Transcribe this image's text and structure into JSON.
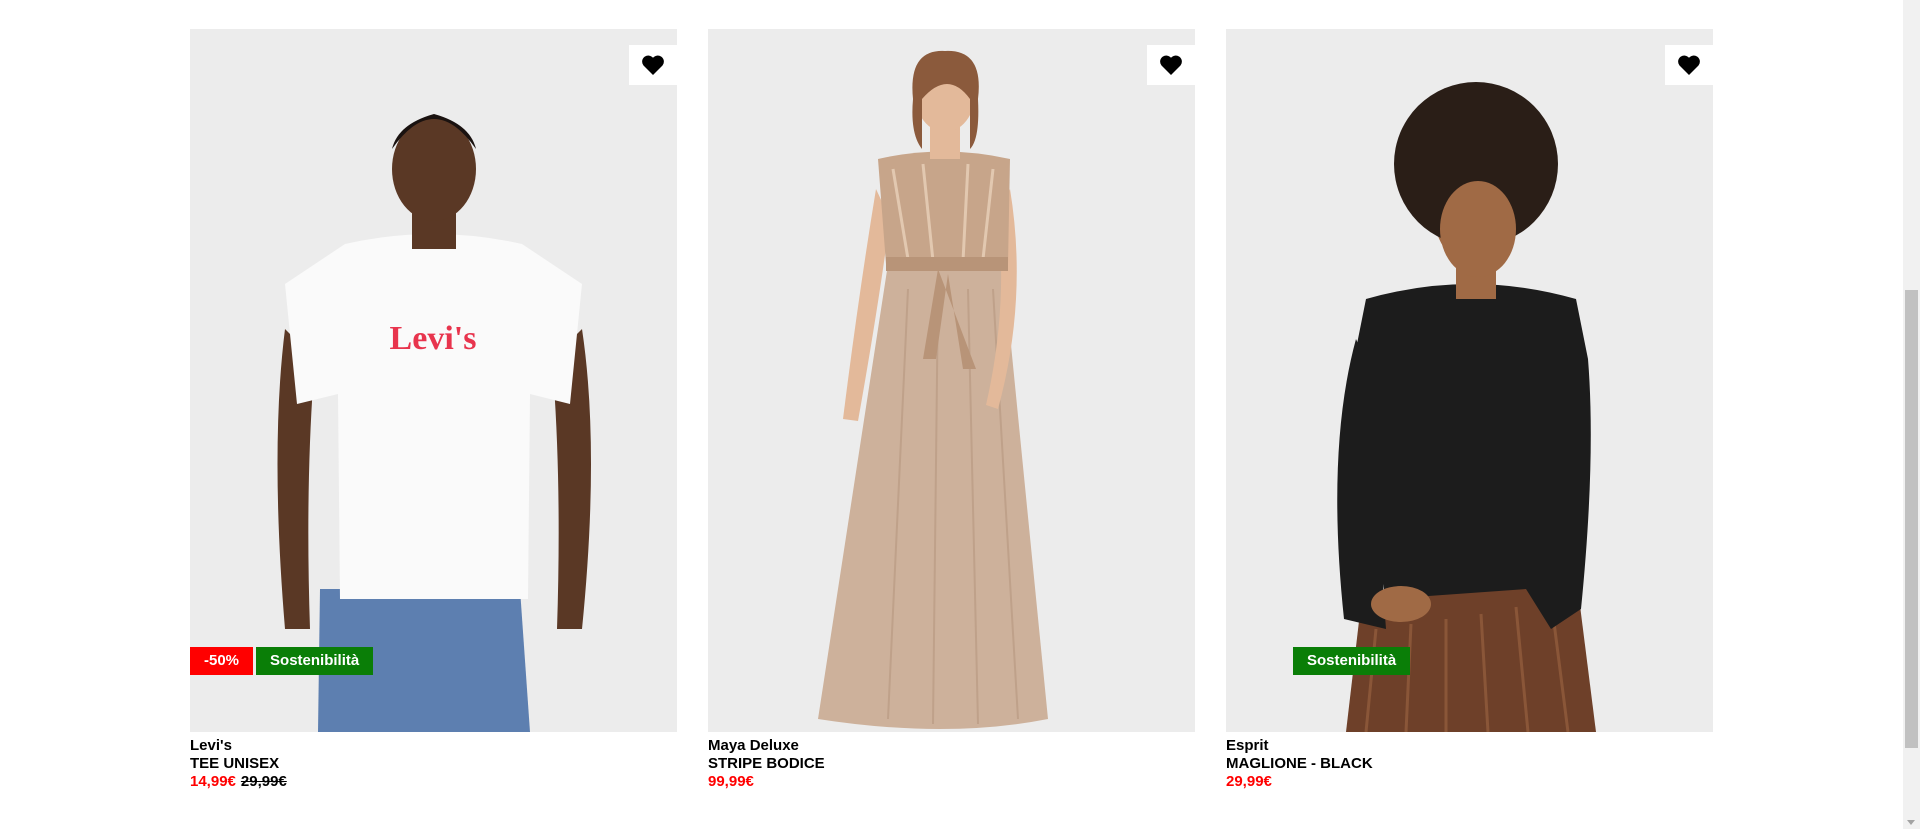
{
  "colors": {
    "price_red": "#ff0000",
    "discount_badge": "#ff0000",
    "sustainability_badge": "#0a7e07",
    "image_bg": "#ececec"
  },
  "products": [
    {
      "brand": "Levi's",
      "name": "TEE UNISEX",
      "price": "14,99€",
      "original_price": "29,99€",
      "discount": "-50%",
      "badge": "Sostenibilità",
      "wishlist_icon": "heart-icon",
      "print_text": "Levi's"
    },
    {
      "brand": "Maya Deluxe",
      "name": "STRIPE BODICE",
      "price": "99,99€",
      "wishlist_icon": "heart-icon"
    },
    {
      "brand": "Esprit",
      "name": "MAGLIONE - BLACK",
      "price": "29,99€",
      "badge": "Sostenibilità",
      "wishlist_icon": "heart-icon"
    }
  ]
}
